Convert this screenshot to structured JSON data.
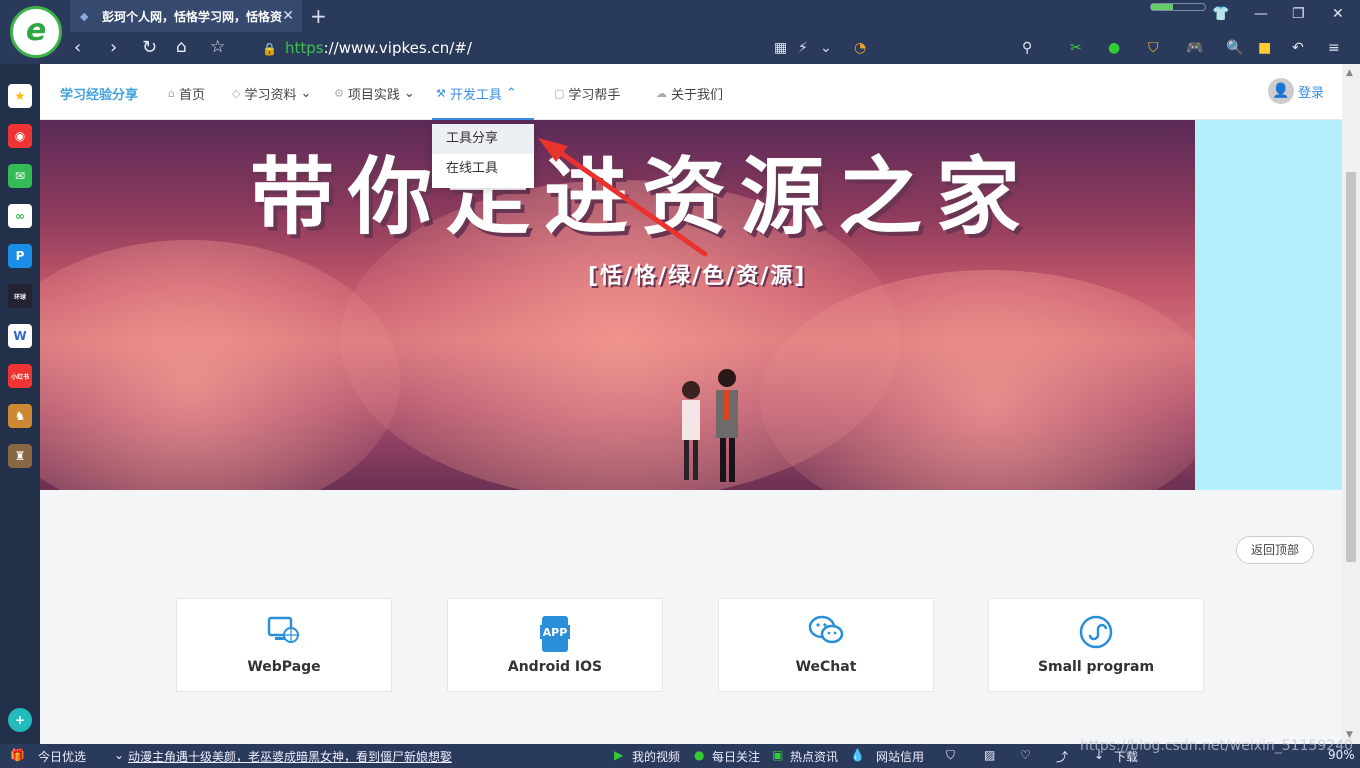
{
  "browser": {
    "tab_title": "彭珂个人网，恬恪学习网，恬恪资",
    "url_protocol": "https",
    "url_rest": "://www.vipkes.cn/#/"
  },
  "site": {
    "brand": "学习经验分享",
    "menu": [
      {
        "label": "首页"
      },
      {
        "label": "学习资料"
      },
      {
        "label": "项目实践"
      },
      {
        "label": "开发工具"
      },
      {
        "label": "学习帮手"
      },
      {
        "label": "关于我们"
      }
    ],
    "login": "登录",
    "dropdown": [
      "工具分享",
      "在线工具"
    ],
    "banner_title": "带你走进资源之家",
    "banner_subtitle": "[恬/恪/绿/色/资/源]",
    "back_to_top": "返回顶部",
    "cards": [
      {
        "label": "WebPage",
        "icon": "webpage-icon"
      },
      {
        "label": "Android IOS",
        "icon": "app-icon"
      },
      {
        "label": "WeChat",
        "icon": "wechat-icon"
      },
      {
        "label": "Small program",
        "icon": "mini-program-icon"
      }
    ]
  },
  "statusbar": {
    "today": "今日优选",
    "news": "动漫主角遇十级美颜，老巫婆成暗黑女神，看到僵尸新娘想娶",
    "my_video": "我的视频",
    "daily": "每日关注",
    "hot": "热点资讯",
    "credit": "网站信用",
    "download": "下载",
    "zoom": "90%"
  },
  "watermark": "https://blog.csdn.net/weixin_51159240",
  "colors": {
    "accent": "#3a8ee6",
    "brand": "#40a0e0",
    "banner_side": "#b3f0fb"
  }
}
